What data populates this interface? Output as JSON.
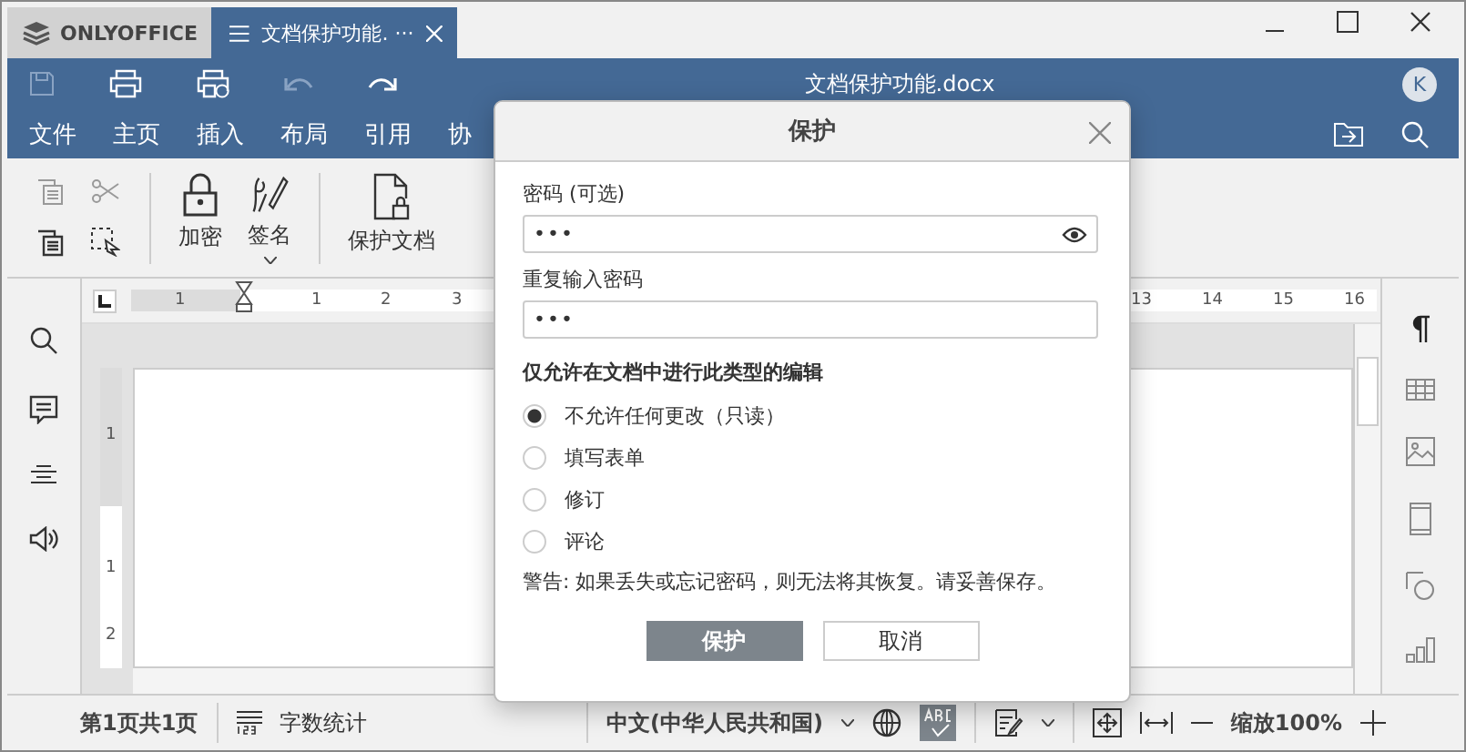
{
  "app_tab": {
    "label": "ONLYOFFICE"
  },
  "doc_tab": {
    "label": "文档保护功能. ···"
  },
  "window_title": "文档保护功能.docx",
  "avatar": "K",
  "menu": [
    "文件",
    "主页",
    "插入",
    "布局",
    "引用",
    "协"
  ],
  "ribbon": [
    {
      "kind": "lock",
      "label": "加密"
    },
    {
      "kind": "sign",
      "label": "签名"
    },
    {
      "kind": "protect",
      "label": "保护文档"
    }
  ],
  "ruler": {
    "left_labels": [
      "1",
      "1",
      "2",
      "3"
    ],
    "right_labels": [
      "13",
      "14",
      "15",
      "16"
    ]
  },
  "vertical_ruler": [
    "1",
    "1",
    "2"
  ],
  "status_bar": {
    "page": "第1页共1页",
    "word_count": "字数统计",
    "language": "中文(中华人民共和国)",
    "spellcheck_on": true,
    "zoom": "缩放100%"
  },
  "dialog": {
    "title": "保护",
    "password_label": "密码 (可选)",
    "password": "•••",
    "repeat_label": "重复输入密码",
    "repeat": "•••",
    "section": "仅允许在文档中进行此类型的编辑",
    "options": [
      {
        "label": "不允许任何更改（只读）",
        "selected": true
      },
      {
        "label": "填写表单",
        "selected": false
      },
      {
        "label": "修订",
        "selected": false
      },
      {
        "label": "评论",
        "selected": false
      }
    ],
    "warning": "警告: 如果丢失或忘记密码，则无法将其恢复。请妥善保存。",
    "ok": "保护",
    "cancel": "取消"
  }
}
